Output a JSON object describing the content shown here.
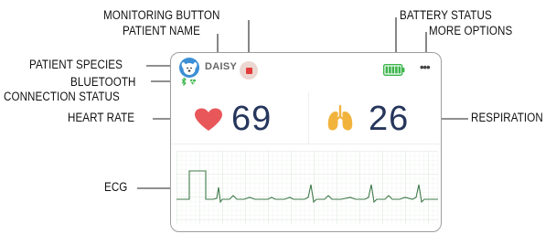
{
  "labels": {
    "monitoring_button": "MONITORING BUTTON",
    "patient_name": "PATIENT NAME",
    "patient_species": "PATIENT SPECIES",
    "bluetooth_line1": "BLUETOOTH",
    "bluetooth_line2": "CONNECTION STATUS",
    "heart_rate": "HEART RATE",
    "ecg": "ECG",
    "battery_status": "BATTERY STATUS",
    "more_options": "MORE OPTIONS",
    "respiration": "RESPIRATION"
  },
  "device": {
    "patient_name": "DAISY",
    "more_options_glyph": "•••",
    "heart_rate": "69",
    "respiration": "26",
    "battery_segments": 5,
    "colors": {
      "heart": "#e8575a",
      "lungs": "#f2b33d",
      "numbers": "#26365c",
      "battery": "#3ab54a",
      "stop": "#e33b3b",
      "ecg_trace": "#3f7a4a",
      "ecg_grid": "#dfe8df"
    }
  }
}
